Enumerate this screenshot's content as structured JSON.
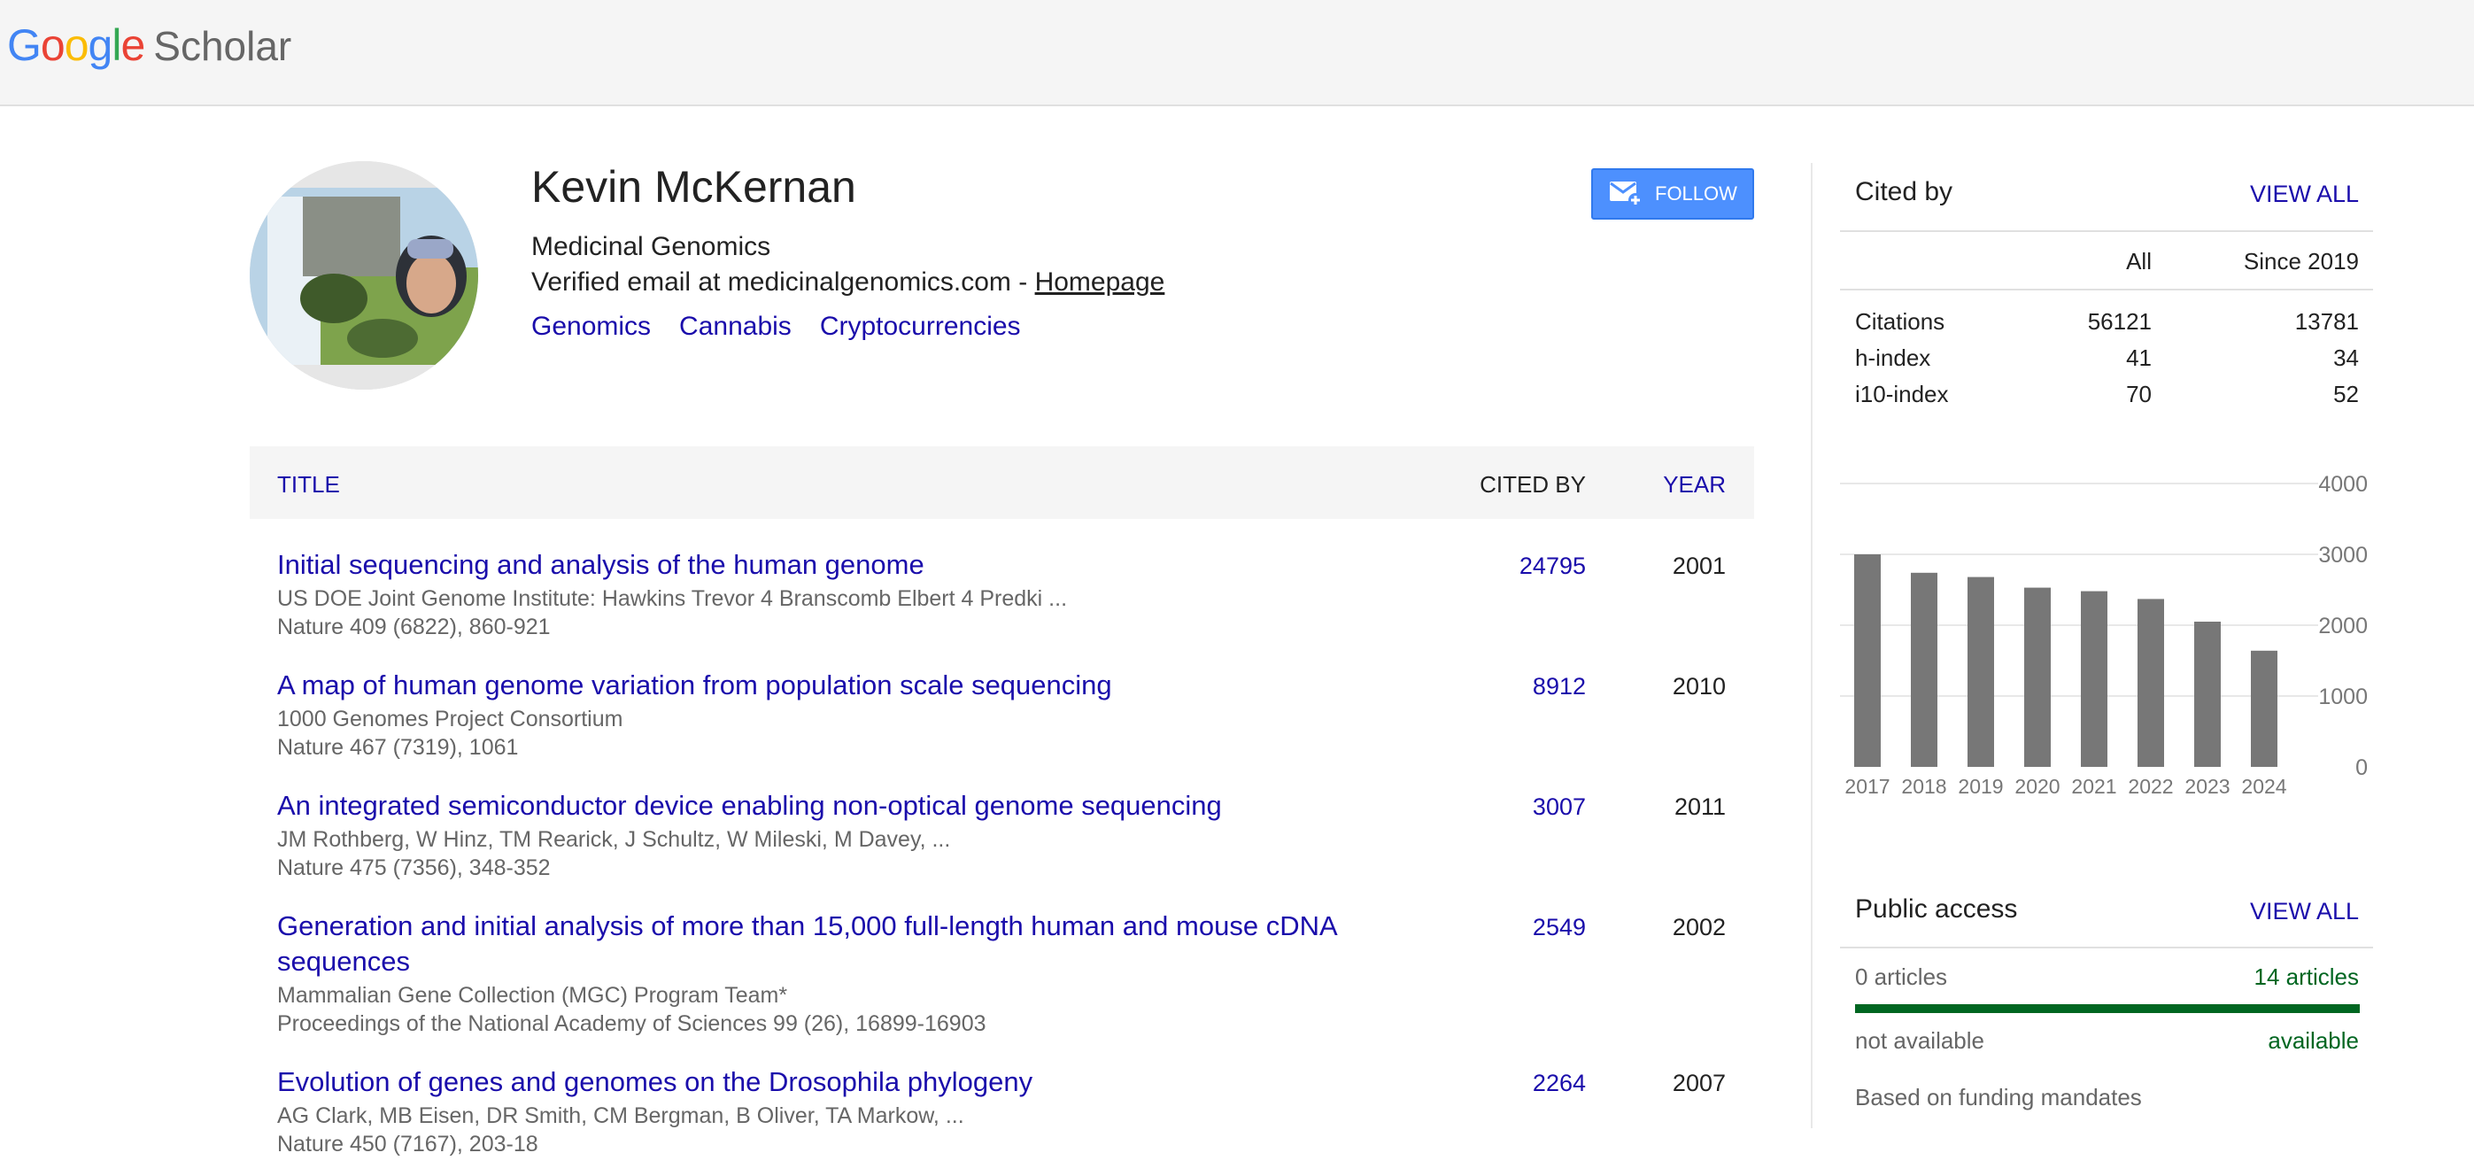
{
  "header": {
    "logo_google": [
      "G",
      "o",
      "o",
      "g",
      "l",
      "e"
    ],
    "logo_google_colors": [
      "#4285f4",
      "#ea4335",
      "#fbbc05",
      "#4285f4",
      "#34a853",
      "#ea4335"
    ],
    "logo_scholar": "Scholar"
  },
  "profile": {
    "name": "Kevin McKernan",
    "affiliation": "Medicinal Genomics",
    "email_text": "Verified email at medicinalgenomics.com - ",
    "homepage_label": "Homepage",
    "interests": [
      "Genomics",
      "Cannabis",
      "Cryptocurrencies"
    ],
    "follow_label": "FOLLOW"
  },
  "table": {
    "col_title": "TITLE",
    "col_cited": "CITED BY",
    "col_year": "YEAR",
    "rows": [
      {
        "title": "Initial sequencing and analysis of the human genome",
        "authors": "US DOE Joint Genome Institute: Hawkins Trevor 4 Branscomb Elbert 4 Predki ...",
        "venue": "Nature 409 (6822), 860-921",
        "cited": "24795",
        "year": "2001"
      },
      {
        "title": "A map of human genome variation from population scale sequencing",
        "authors": "1000 Genomes Project Consortium",
        "venue": "Nature 467 (7319), 1061",
        "cited": "8912",
        "year": "2010"
      },
      {
        "title": "An integrated semiconductor device enabling non-optical genome sequencing",
        "authors": "JM Rothberg, W Hinz, TM Rearick, J Schultz, W Mileski, M Davey, ...",
        "venue": "Nature 475 (7356), 348-352",
        "cited": "3007",
        "year": "2011"
      },
      {
        "title": "Generation and initial analysis of more than 15,000 full-length human and mouse cDNA sequences",
        "authors": "Mammalian Gene Collection (MGC) Program Team*",
        "venue": "Proceedings of the National Academy of Sciences 99 (26), 16899-16903",
        "cited": "2549",
        "year": "2002"
      },
      {
        "title": "Evolution of genes and genomes on the Drosophila phylogeny",
        "authors": "AG Clark, MB Eisen, DR Smith, CM Bergman, B Oliver, TA Markow, ...",
        "venue": "Nature 450 (7167), 203-18",
        "cited": "2264",
        "year": "2007"
      }
    ]
  },
  "cited_by": {
    "title": "Cited by",
    "view_all": "VIEW ALL",
    "col_all": "All",
    "col_since": "Since 2019",
    "stats": [
      {
        "label": "Citations",
        "all": "56121",
        "since": "13781"
      },
      {
        "label": "h-index",
        "all": "41",
        "since": "34"
      },
      {
        "label": "i10-index",
        "all": "70",
        "since": "52"
      }
    ]
  },
  "chart_data": {
    "type": "bar",
    "categories": [
      "2017",
      "2018",
      "2019",
      "2020",
      "2021",
      "2022",
      "2023",
      "2024"
    ],
    "values": [
      3000,
      2740,
      2680,
      2530,
      2480,
      2370,
      2050,
      1640
    ],
    "yticks": [
      "0",
      "1000",
      "2000",
      "3000",
      "4000"
    ],
    "ylim": [
      0,
      4000
    ],
    "bar_color": "#777777",
    "grid": true
  },
  "public_access": {
    "title": "Public access",
    "view_all": "VIEW ALL",
    "not_available_count": "0 articles",
    "available_count": "14 articles",
    "available_fraction": 1.0,
    "not_available_label": "not available",
    "available_label": "available",
    "note": "Based on funding mandates",
    "available_color": "#006621"
  }
}
